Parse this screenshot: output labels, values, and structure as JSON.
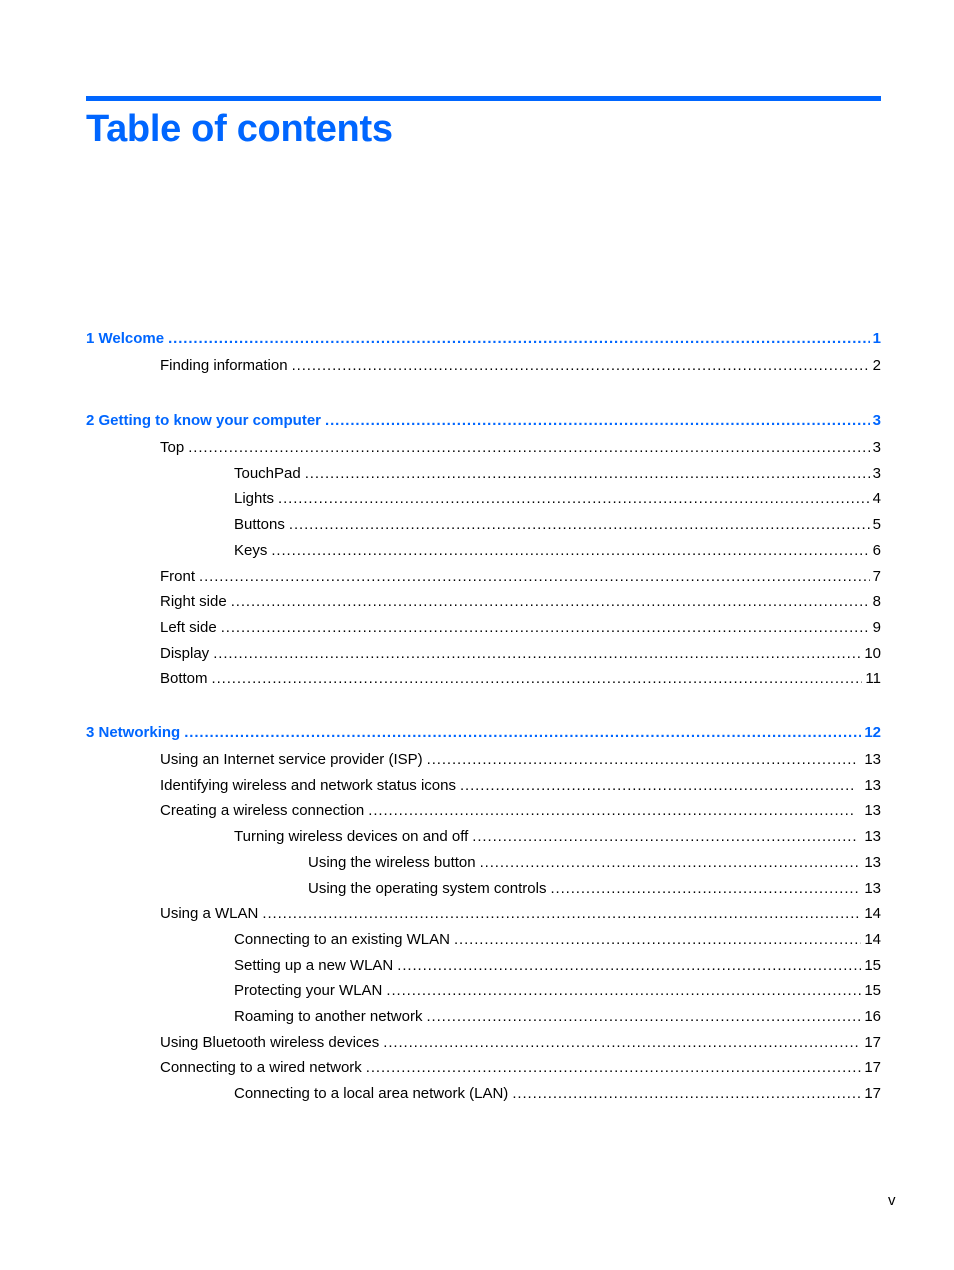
{
  "title": "Table of contents",
  "accent_color": "#0066ff",
  "chapters": [
    {
      "number": "1",
      "label": "1  Welcome",
      "page": "1",
      "entries": [
        {
          "label": "Finding information",
          "page": "2",
          "level": 2
        }
      ]
    },
    {
      "number": "2",
      "label": "2  Getting to know your computer",
      "page": "3",
      "entries": [
        {
          "label": "Top",
          "page": "3",
          "level": 2
        },
        {
          "label": "TouchPad",
          "page": "3",
          "level": 3
        },
        {
          "label": "Lights",
          "page": "4",
          "level": 3
        },
        {
          "label": "Buttons",
          "page": "5",
          "level": 3
        },
        {
          "label": "Keys",
          "page": "6",
          "level": 3
        },
        {
          "label": "Front",
          "page": "7",
          "level": 2
        },
        {
          "label": "Right side",
          "page": "8",
          "level": 2
        },
        {
          "label": "Left side",
          "page": "9",
          "level": 2
        },
        {
          "label": "Display",
          "page": "10",
          "level": 2
        },
        {
          "label": "Bottom",
          "page": "11",
          "level": 2
        }
      ]
    },
    {
      "number": "3",
      "label": "3  Networking",
      "page": "12",
      "entries": [
        {
          "label": "Using an Internet service provider (ISP)",
          "page": "13",
          "level": 2
        },
        {
          "label": "Identifying wireless and network status icons",
          "page": "13",
          "level": 2
        },
        {
          "label": "Creating a wireless connection",
          "page": "13",
          "level": 2
        },
        {
          "label": "Turning wireless devices on and off",
          "page": "13",
          "level": 3
        },
        {
          "label": "Using the wireless button",
          "page": "13",
          "level": 4
        },
        {
          "label": "Using the operating system controls",
          "page": "13",
          "level": 4
        },
        {
          "label": "Using a WLAN",
          "page": "14",
          "level": 2
        },
        {
          "label": "Connecting to an existing WLAN",
          "page": "14",
          "level": 3
        },
        {
          "label": "Setting up a new WLAN",
          "page": "15",
          "level": 3
        },
        {
          "label": "Protecting your WLAN",
          "page": "15",
          "level": 3
        },
        {
          "label": "Roaming to another network",
          "page": "16",
          "level": 3
        },
        {
          "label": "Using Bluetooth wireless devices",
          "page": "17",
          "level": 2
        },
        {
          "label": "Connecting to a wired network",
          "page": "17",
          "level": 2
        },
        {
          "label": "Connecting to a local area network (LAN)",
          "page": "17",
          "level": 3
        }
      ]
    }
  ],
  "footer": {
    "page_number": "v"
  }
}
